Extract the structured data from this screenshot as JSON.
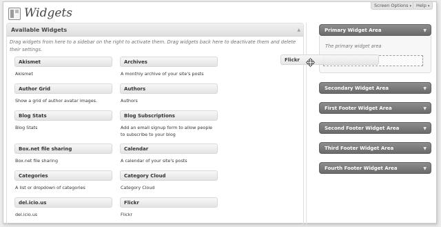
{
  "page": {
    "title": "Widgets",
    "icon": "widgets-page-icon"
  },
  "top_tabs": {
    "screen_options": "Screen Options",
    "help": "Help"
  },
  "available": {
    "title": "Available Widgets",
    "description": "Drag widgets from here to a sidebar on the right to activate them. Drag widgets back here to deactivate them and delete their settings.",
    "widgets": [
      {
        "title": "Akismet",
        "desc": "Akismet"
      },
      {
        "title": "Archives",
        "desc": "A monthly archive of your site's posts"
      },
      {
        "title": "Author Grid",
        "desc": "Show a grid of author avatar images."
      },
      {
        "title": "Authors",
        "desc": "Authors"
      },
      {
        "title": "Blog Stats",
        "desc": "Blog Stats"
      },
      {
        "title": "Blog Subscriptions",
        "desc": "Add an email signup form to allow people to subscribe to your blog"
      },
      {
        "title": "Box.net file sharing",
        "desc": "Box.net file sharing"
      },
      {
        "title": "Calendar",
        "desc": "A calendar of your site's posts"
      },
      {
        "title": "Categories",
        "desc": "A list or dropdown of categories"
      },
      {
        "title": "Category Cloud",
        "desc": "Category Cloud"
      },
      {
        "title": "del.icio.us",
        "desc": "del.icio.us"
      },
      {
        "title": "Flickr",
        "desc": "Flickr"
      }
    ]
  },
  "dragging_widget": {
    "title": "Flickr"
  },
  "sidebars": {
    "primary": {
      "title": "Primary Widget Area",
      "description": "The primary widget area"
    },
    "secondary": {
      "title": "Secondary Widget Area"
    },
    "first_footer": {
      "title": "First Footer Widget Area"
    },
    "second_footer": {
      "title": "Second Footer Widget Area"
    },
    "third_footer": {
      "title": "Third Footer Widget Area"
    },
    "fourth_footer": {
      "title": "Fourth Footer Widget Area"
    }
  },
  "colors": {
    "sidebar_header": "#7a7a7a",
    "widget_title_bg": "#ececec",
    "accent_text": "#464646"
  }
}
